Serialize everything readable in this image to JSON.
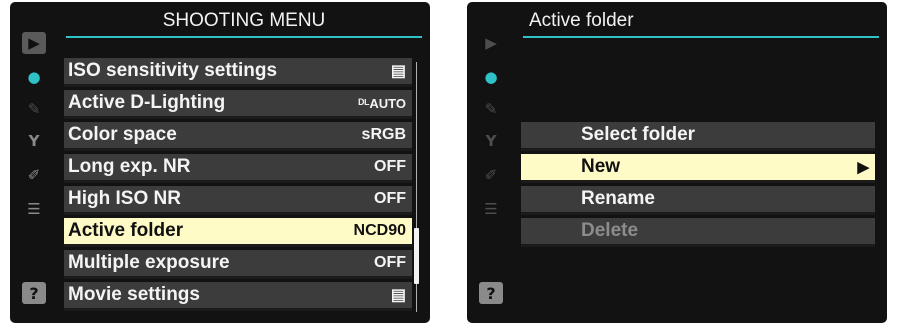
{
  "left_screen": {
    "title": "SHOOTING MENU",
    "sidebar": {
      "play": "▶",
      "shoot": "●",
      "retouch": "✎",
      "setup": "Y",
      "retouch2": "✐",
      "recent": "☰",
      "help": "?"
    },
    "rows": [
      {
        "label": "ISO sensitivity settings",
        "value": "▤"
      },
      {
        "label": "Active D-Lighting",
        "value": "ᴰᴸAUTO"
      },
      {
        "label": "Color space",
        "value": "sRGB"
      },
      {
        "label": "Long exp. NR",
        "value": "OFF"
      },
      {
        "label": "High ISO NR",
        "value": "OFF"
      },
      {
        "label": "Active folder",
        "value": "NCD90"
      },
      {
        "label": "Multiple exposure",
        "value": "OFF"
      },
      {
        "label": "Movie settings",
        "value": "▤"
      }
    ],
    "scroll_position": 0.66
  },
  "right_screen": {
    "title": "Active folder",
    "sidebar": {
      "play": "▶",
      "shoot": "●",
      "retouch": "✎",
      "setup": "Y",
      "retouch2": "✐",
      "recent": "☰",
      "help": "?"
    },
    "rows": [
      {
        "label": "Select folder"
      },
      {
        "label": "New",
        "arrow": "▶"
      },
      {
        "label": "Rename"
      },
      {
        "label": "Delete"
      }
    ]
  },
  "colors": {
    "accent": "#2ec1c6",
    "highlight": "#fffbc6",
    "row": "#3c3c3c",
    "background": "#121212"
  }
}
